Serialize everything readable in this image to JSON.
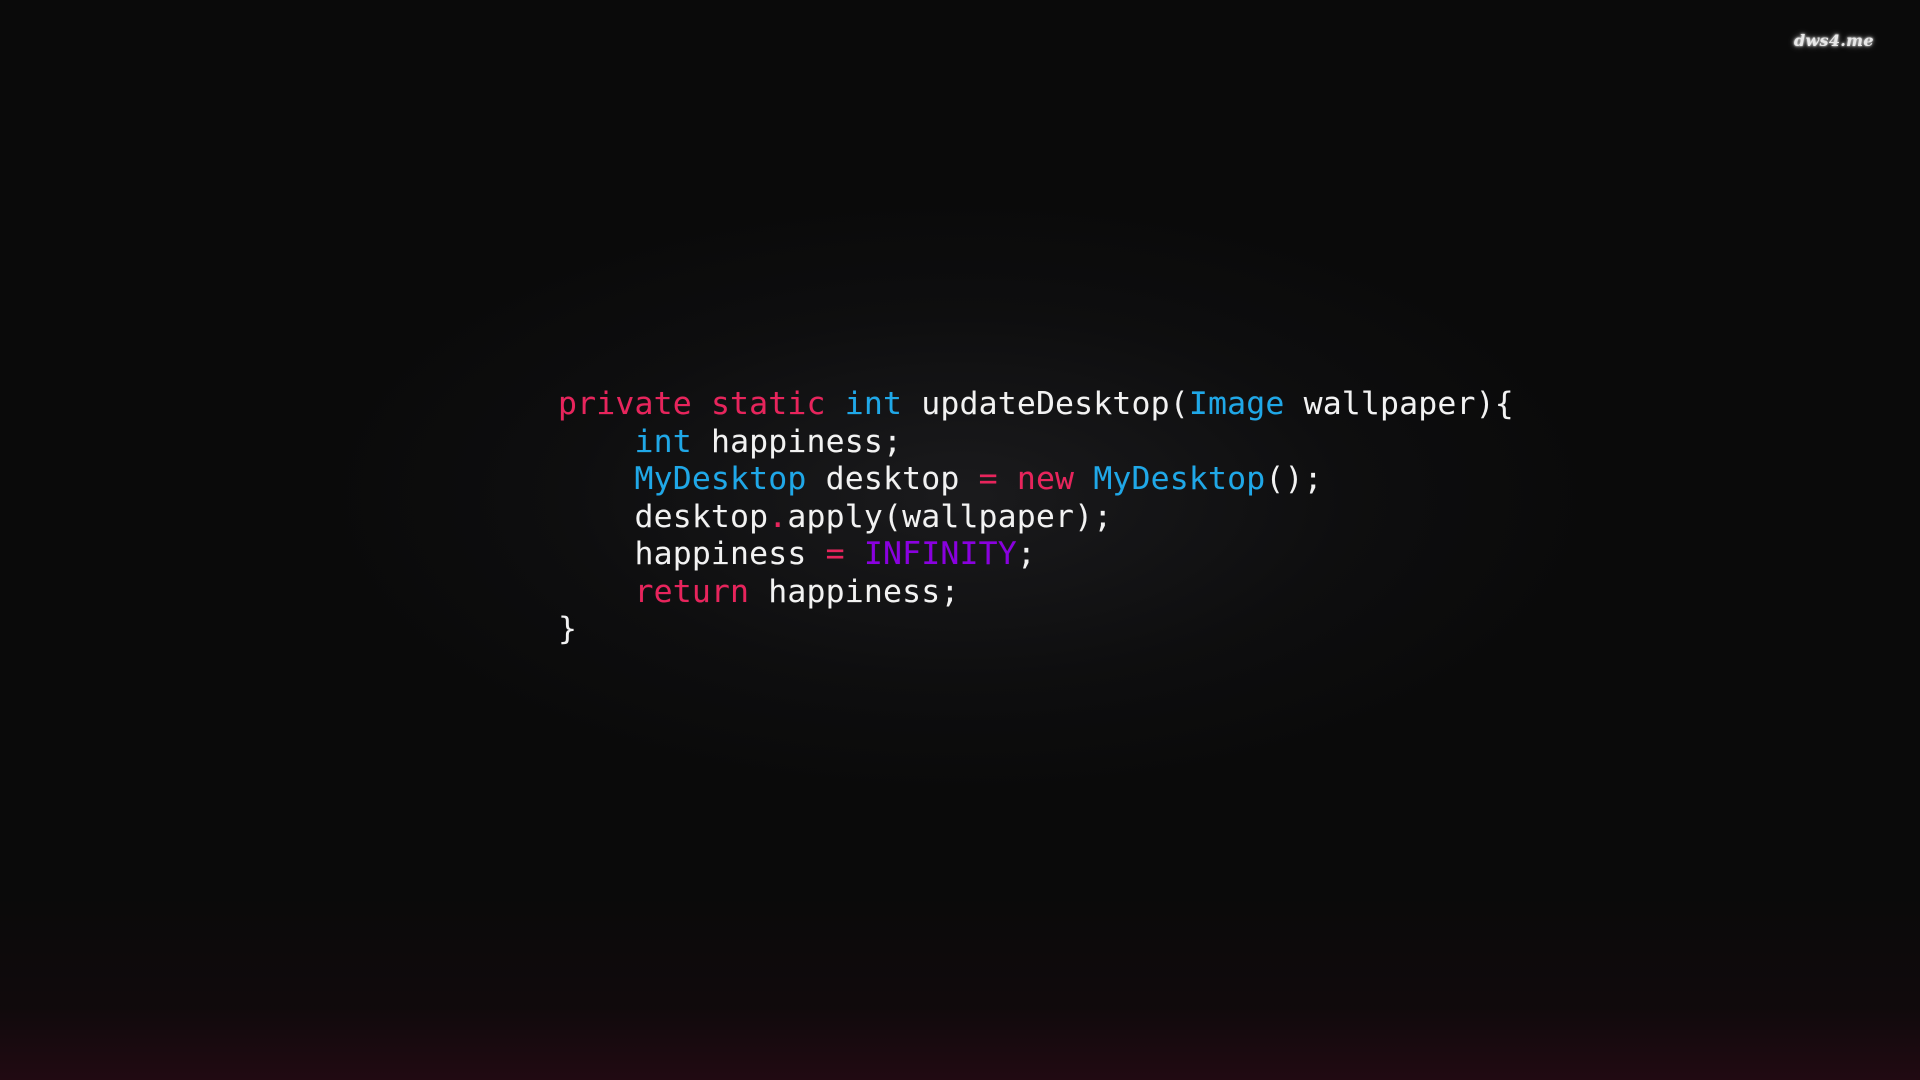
{
  "wallpaper": {
    "background_color": "#0a0a0a",
    "watermark": "dws4.me"
  },
  "palette": {
    "keyword": "#e8245c",
    "type": "#1fa8e8",
    "constant": "#8a00e0",
    "plain": "#f2f2f2",
    "background": "#0a0a0a"
  },
  "code": {
    "language": "java",
    "line1": {
      "kw_private": "private",
      "sp1": " ",
      "kw_static": "static",
      "sp2": " ",
      "type_int": "int",
      "sp3": " ",
      "fn_name": "updateDesktop",
      "paren_open": "(",
      "type_image": "Image",
      "sp4": " ",
      "param": "wallpaper",
      "paren_close": ")",
      "brace_open": "{"
    },
    "line2": {
      "indent": "    ",
      "type_int": "int",
      "sp1": " ",
      "var": "happiness;"
    },
    "line3": {
      "indent": "    ",
      "type_mydesktop": "MyDesktop",
      "sp1": " ",
      "var": "desktop",
      "sp2": " ",
      "op_assign": "=",
      "sp3": " ",
      "kw_new": "new",
      "sp4": " ",
      "ctor": "MyDesktop",
      "tail": "();"
    },
    "line4": {
      "indent": "    ",
      "obj": "desktop",
      "dot": ".",
      "call": "apply(wallpaper);"
    },
    "line5": {
      "indent": "    ",
      "var": "happiness",
      "sp1": " ",
      "op_assign": "=",
      "sp2": " ",
      "const_infinity": "INFINITY",
      "semicolon": ";"
    },
    "line6": {
      "indent": "    ",
      "kw_return": "return",
      "sp1": " ",
      "var": "happiness;"
    },
    "line7": {
      "brace_close": "}"
    }
  }
}
